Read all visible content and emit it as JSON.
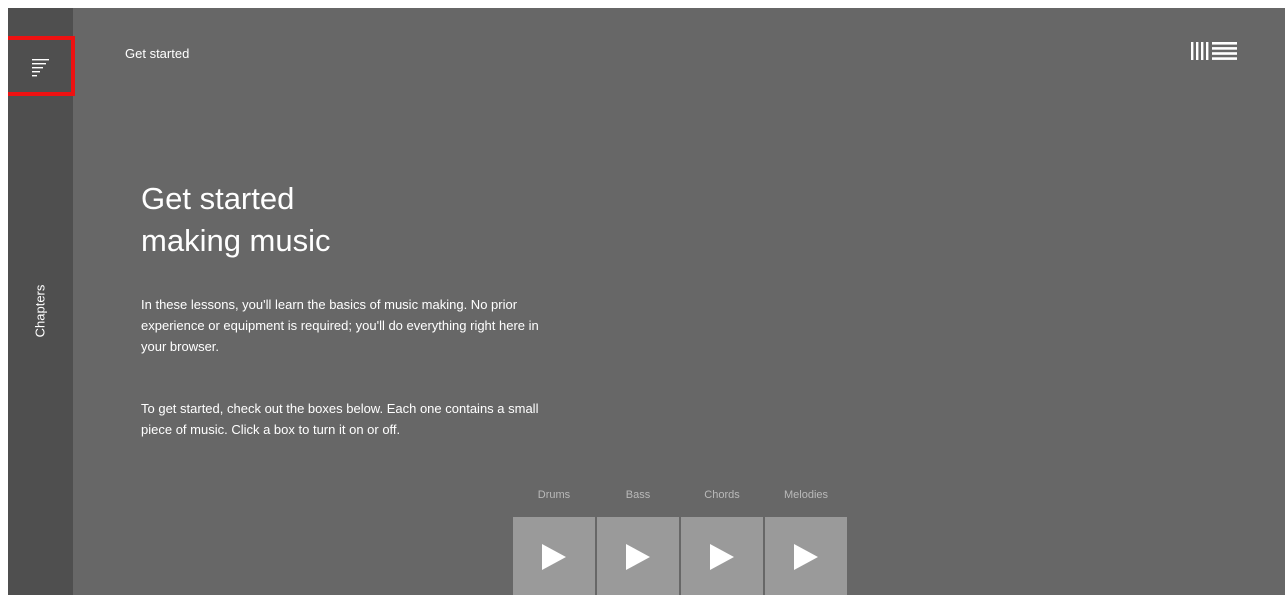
{
  "sidebar": {
    "menu_icon": "menu-lines-icon",
    "chapters_label": "Chapters"
  },
  "header": {
    "breadcrumb": "Get started",
    "logo_icon": "ableton-logo-icon"
  },
  "main": {
    "title_line1": "Get started",
    "title_line2": "making music",
    "paragraph1": "In these lessons, you'll learn the basics of music making. No prior experience or equipment is required; you'll do everything right here in your browser.",
    "paragraph2": "To get started, check out the boxes below. Each one contains a small piece of music. Click a box to turn it on or off."
  },
  "pads": [
    {
      "label": "Drums",
      "icon": "play-icon"
    },
    {
      "label": "Bass",
      "icon": "play-icon"
    },
    {
      "label": "Chords",
      "icon": "play-icon"
    },
    {
      "label": "Melodies",
      "icon": "play-icon"
    }
  ],
  "colors": {
    "background": "#676767",
    "sidebar": "#4f4f4f",
    "pad": "#9a9a9a",
    "highlight": "#ee1111",
    "text": "#ffffff"
  }
}
